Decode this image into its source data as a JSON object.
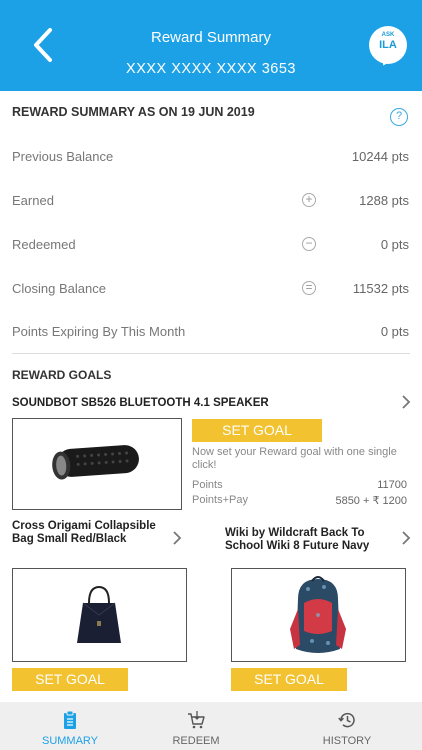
{
  "header": {
    "title": "Reward Summary",
    "card_number": "XXXX XXXX XXXX 3653",
    "ask_small": "ASK",
    "ask_big": "ILA"
  },
  "summary": {
    "heading": "REWARD SUMMARY AS ON 19 JUN 2019",
    "help_symbol": "?",
    "rows": [
      {
        "label": "Previous Balance",
        "value": "10244 pts",
        "icon": ""
      },
      {
        "label": "Earned",
        "value": "1288 pts",
        "icon": "plus-circle-icon",
        "symbol": "+"
      },
      {
        "label": "Redeemed",
        "value": "0 pts",
        "icon": "minus-circle-icon",
        "symbol": "−"
      },
      {
        "label": "Closing Balance",
        "value": "11532 pts",
        "icon": "equals-circle-icon",
        "symbol": "="
      },
      {
        "label": "Points Expiring By This Month",
        "value": "0 pts",
        "icon": ""
      }
    ]
  },
  "goals": {
    "heading": "REWARD GOALS",
    "featured": {
      "title": "SOUNDBOT SB526 BLUETOOTH 4.1 SPEAKER",
      "button": "SET GOAL",
      "description": "Now set your Reward goal with one single click!",
      "points_label": "Points",
      "points_value": "11700",
      "pointspay_label": "Points+Pay",
      "pointspay_value": "5850 + ₹ 1200"
    },
    "items": [
      {
        "title": "Cross Origami Collapsible Bag Small Red/Black",
        "button": "SET GOAL"
      },
      {
        "title": "Wiki by Wildcraft Back To School Wiki 8 Future Navy",
        "button": "SET GOAL"
      }
    ]
  },
  "nav": {
    "summary": "SUMMARY",
    "redeem": "REDEEM",
    "history": "HISTORY",
    "active_color": "#1da1e6",
    "inactive_color": "#666666"
  },
  "colors": {
    "brand_blue": "#1da1e6",
    "goal_yellow": "#f2c230"
  }
}
